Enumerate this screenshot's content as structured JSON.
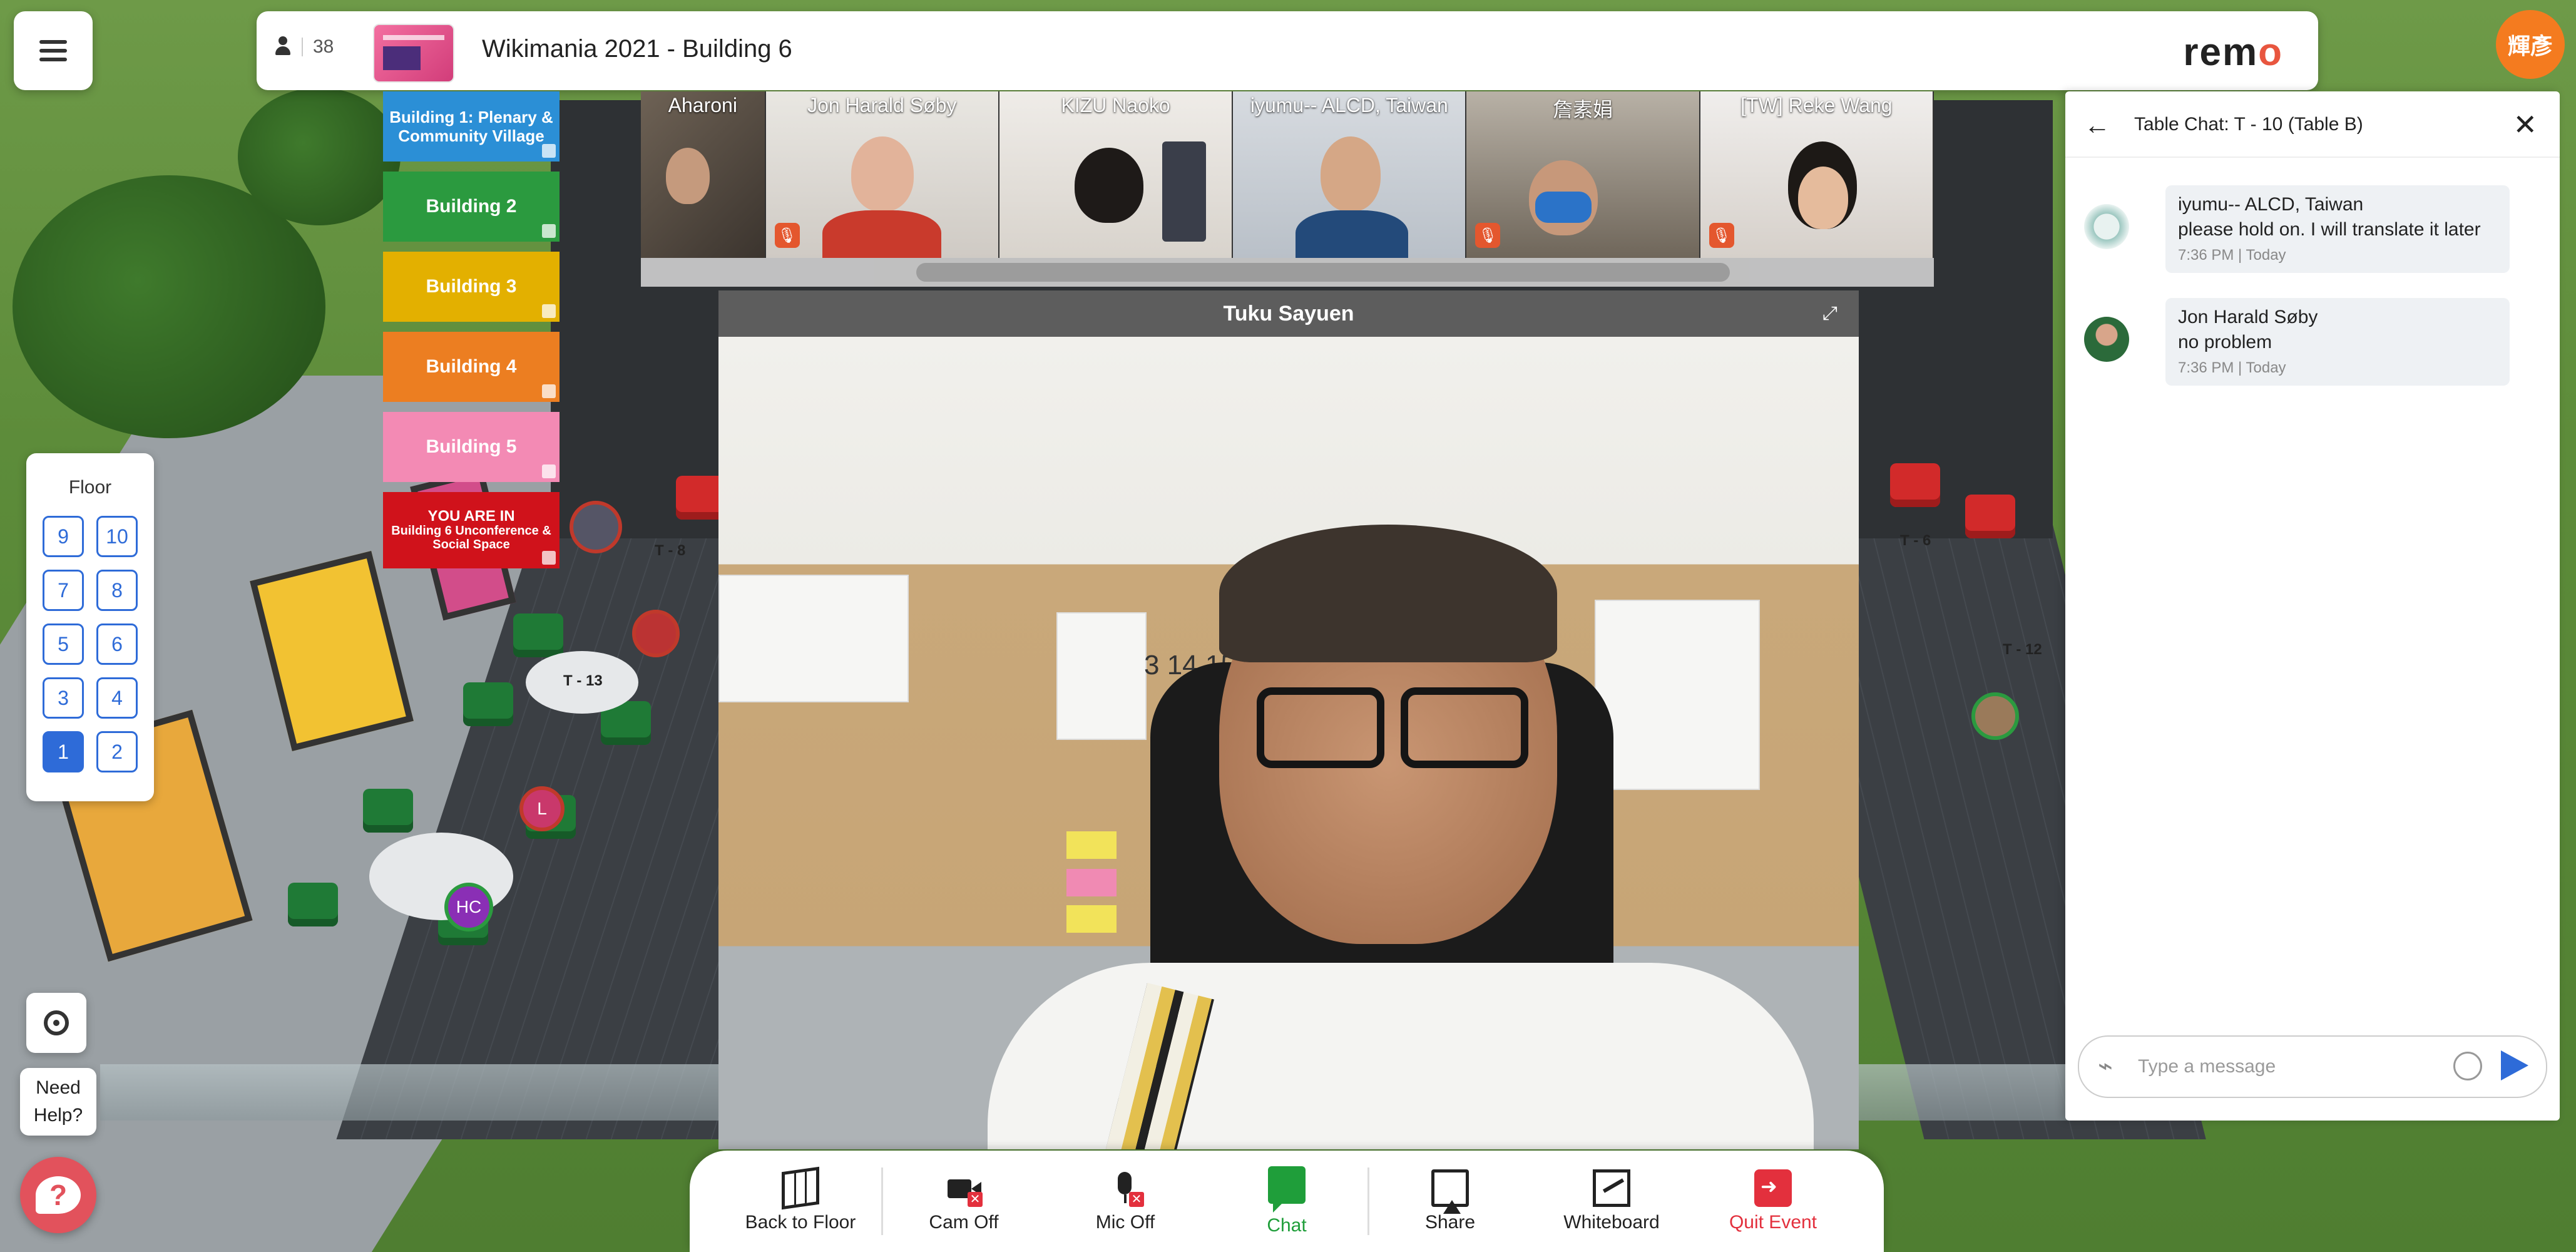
{
  "header": {
    "participant_count": "38",
    "event_title": "Wikimania 2021 - Building 6",
    "logo": "remo",
    "user_avatar_initials": "輝彥"
  },
  "buildings": [
    {
      "label": "Building 1: Plenary & Community Village",
      "color": "#2b8fd6"
    },
    {
      "label": "Building 2",
      "color": "#2b9a3f"
    },
    {
      "label": "Building 3",
      "color": "#e3b000"
    },
    {
      "label": "Building 4",
      "color": "#ec7e21"
    },
    {
      "label": "Building 5",
      "color": "#f38ab4"
    },
    {
      "label": "YOU ARE IN",
      "sub": "Building 6 Unconference & Social Space",
      "color": "#d0121b"
    }
  ],
  "participants": [
    {
      "name": "Aharoni",
      "muted": false
    },
    {
      "name": "Jon Harald Søby",
      "muted": true
    },
    {
      "name": "KIZU Naoko",
      "muted": false
    },
    {
      "name": "iyumu-- ALCD, Taiwan",
      "muted": false
    },
    {
      "name": "詹素娟",
      "muted": true
    },
    {
      "name": "[TW] Reke Wang",
      "muted": true
    }
  ],
  "main_video": {
    "speaker": "Tuku Sayuen",
    "calendar_text": "3 14 15"
  },
  "floor_panel": {
    "title": "Floor",
    "floors": [
      "9",
      "10",
      "7",
      "8",
      "5",
      "6",
      "3",
      "4",
      "1",
      "2"
    ],
    "active_floor": "1"
  },
  "help": {
    "label_line1": "Need",
    "label_line2": "Help?"
  },
  "chat": {
    "title": "Table Chat: T - 10 (Table B)",
    "messages": [
      {
        "author": "iyumu-- ALCD, Taiwan",
        "text": "please hold on. I will translate it later",
        "time": "7:36 PM | Today"
      },
      {
        "author": "Jon Harald Søby",
        "text": "no problem",
        "time": "7:36 PM | Today"
      }
    ],
    "input_placeholder": "Type a message"
  },
  "toolbar": {
    "back_to_floor": "Back to Floor",
    "cam_off": "Cam Off",
    "mic_off": "Mic Off",
    "chat": "Chat",
    "share": "Share",
    "whiteboard": "Whiteboard",
    "quit_event": "Quit Event"
  },
  "scene": {
    "table_labels": [
      "T - 13",
      "T - 8",
      "T - 6",
      "T - 12"
    ],
    "floor_avatars": [
      "L",
      "HC"
    ]
  },
  "colors": {
    "accent_blue": "#2e6bd8",
    "chat_green": "#1f9e3a",
    "quit_red": "#e3303d",
    "logo_accent": "#e8563f",
    "avatar_orange": "#f47b1f"
  }
}
